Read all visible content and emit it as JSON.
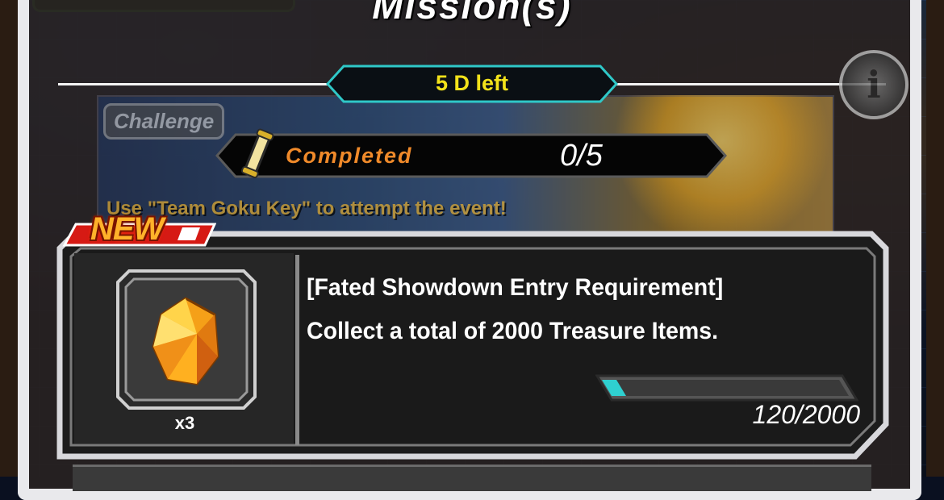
{
  "header": {
    "title": "Mission(s)"
  },
  "timer": {
    "label": "5 D left",
    "color": "#f2e21a"
  },
  "banner": {
    "tag": "Challenge",
    "text": "Use \"Team Goku Key\" to attempt the event!"
  },
  "completed": {
    "label": "Completed",
    "count": "0/5"
  },
  "mission": {
    "badge": "NEW",
    "title": "[Fated Showdown Entry Requirement]",
    "description": "Collect a total of 2000 Treasure Items.",
    "reward": {
      "icon": "orange-crystal-icon",
      "quantity": "x3"
    },
    "progress": {
      "current": 120,
      "total": 2000,
      "fraction": 0.06,
      "text": "120/2000"
    }
  },
  "colors": {
    "accent_cyan": "#2fc8c8",
    "orange": "#f08a2a",
    "frame": "#d8d8dc",
    "badge_red": "#e0201a"
  }
}
